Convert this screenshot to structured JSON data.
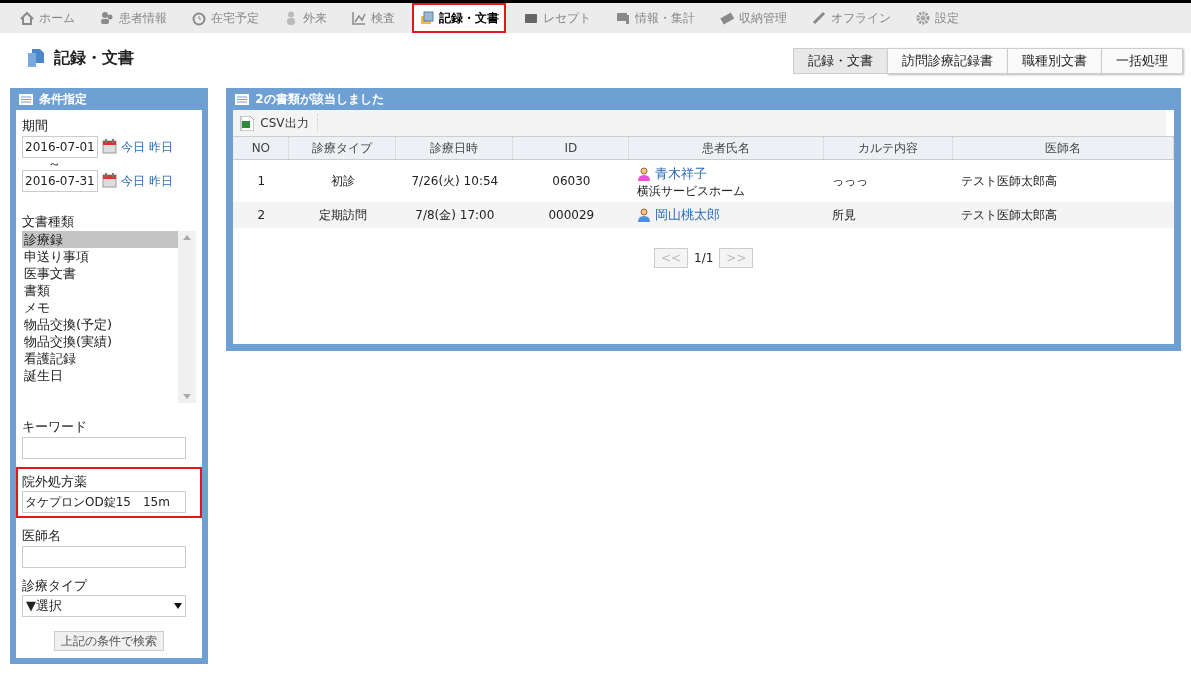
{
  "nav": [
    {
      "label": "ホーム",
      "selected": false,
      "highlighted": false
    },
    {
      "label": "患者情報",
      "selected": false,
      "highlighted": false
    },
    {
      "label": "在宅予定",
      "selected": false,
      "highlighted": false
    },
    {
      "label": "外来",
      "selected": false,
      "highlighted": false
    },
    {
      "label": "検査",
      "selected": false,
      "highlighted": false
    },
    {
      "label": "記録・文書",
      "selected": true,
      "highlighted": true
    },
    {
      "label": "レセプト",
      "selected": false,
      "highlighted": false
    },
    {
      "label": "情報・集計",
      "selected": false,
      "highlighted": false
    },
    {
      "label": "収納管理",
      "selected": false,
      "highlighted": false
    },
    {
      "label": "オフライン",
      "selected": false,
      "highlighted": false
    },
    {
      "label": "設定",
      "selected": false,
      "highlighted": false
    }
  ],
  "page_title": "記録・文書",
  "sub_tabs": [
    {
      "label": "記録・文書",
      "selected": true
    },
    {
      "label": "訪問診療記録書",
      "selected": false
    },
    {
      "label": "職種別文書",
      "selected": false
    },
    {
      "label": "一括処理",
      "selected": false
    }
  ],
  "filter_panel": {
    "title": "条件指定",
    "period": {
      "label": "期間",
      "separator": "～",
      "dates": [
        {
          "value": "2016-07-01",
          "today": "今日",
          "yesterday": "昨日"
        },
        {
          "value": "2016-07-31",
          "today": "今日",
          "yesterday": "昨日"
        }
      ]
    },
    "doc_types": {
      "label": "文書種類",
      "items": [
        {
          "label": "診療録",
          "selected": true
        },
        {
          "label": "申送り事項",
          "selected": false
        },
        {
          "label": "医事文書",
          "selected": false
        },
        {
          "label": "書類",
          "selected": false
        },
        {
          "label": "メモ",
          "selected": false
        },
        {
          "label": "物品交換(予定)",
          "selected": false
        },
        {
          "label": "物品交換(実績)",
          "selected": false
        },
        {
          "label": "看護記録",
          "selected": false
        },
        {
          "label": "誕生日",
          "selected": false
        }
      ]
    },
    "fields": [
      {
        "label": "キーワード",
        "highlighted": false
      },
      {
        "label": "院外処方薬",
        "value": "タケプロンOD錠15　15m",
        "highlighted": true
      },
      {
        "label": "医師名",
        "highlighted": false
      }
    ],
    "visit_type": {
      "label": "診療タイプ",
      "value": "▼選択"
    },
    "search_button": "上記の条件で検索"
  },
  "results": {
    "title": "2の書類が該当しました",
    "csv_button": "CSV出力",
    "columns": [
      "NO",
      "診療タイプ",
      "診療日時",
      "ID",
      "患者氏名",
      "カルテ内容",
      "医師名"
    ],
    "rows": [
      {
        "no": "1",
        "type": "初診",
        "datetime": "7/26(火) 10:54",
        "id": "06030",
        "patient": "青木祥子",
        "kind": "female",
        "facility": "横浜サービスホーム",
        "content": "っっっ",
        "doctor": "テスト医師太郎高"
      },
      {
        "no": "2",
        "type": "定期訪問",
        "datetime": "7/8(金) 17:00",
        "id": "000029",
        "patient": "岡山桃太郎",
        "kind": "male",
        "content": "所見",
        "doctor": "テスト医師太郎高"
      }
    ],
    "pager": {
      "prev": "<<",
      "page": "1/1",
      "next": ">>"
    }
  }
}
